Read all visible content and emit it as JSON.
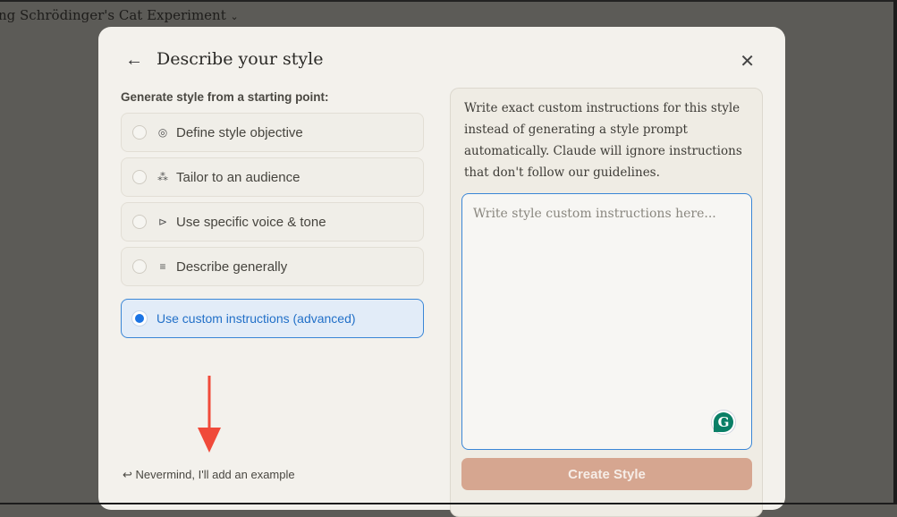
{
  "conversation_title": "ng Schrödinger's Cat Experiment",
  "modal": {
    "title": "Describe your style",
    "subheading": "Generate style from a starting point:",
    "options": [
      {
        "label": "Define style objective",
        "icon": "target-icon",
        "selected": false
      },
      {
        "label": "Tailor to an audience",
        "icon": "people-icon",
        "selected": false
      },
      {
        "label": "Use specific voice & tone",
        "icon": "megaphone-icon",
        "selected": false
      },
      {
        "label": "Describe generally",
        "icon": "lines-icon",
        "selected": false
      },
      {
        "label": "Use custom instructions (advanced)",
        "icon": "",
        "selected": true
      }
    ],
    "nevermind": "Nevermind, I'll add an example",
    "custom_description": "Write exact custom instructions for this style instead of generating a style prompt automatically. Claude will ignore instructions that don't follow our guidelines.",
    "textarea_placeholder": "Write style custom instructions here...",
    "create_button": "Create Style"
  },
  "colors": {
    "accent": "#1b74e4",
    "create_button": "#d6a690",
    "annotation_arrow": "#f04a3a"
  }
}
